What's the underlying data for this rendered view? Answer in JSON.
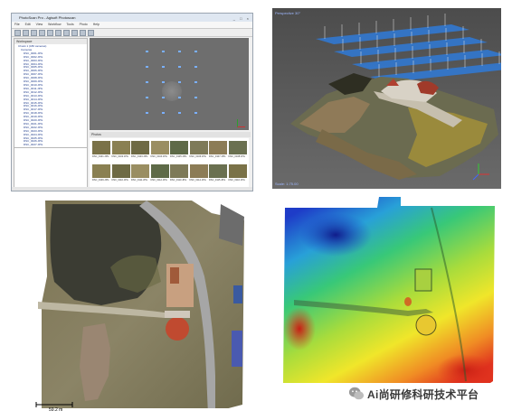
{
  "software_window": {
    "title": "PhotoScan Pro - Agisoft Photoscan",
    "menu": [
      "File",
      "Edit",
      "View",
      "Workflow",
      "Tools",
      "Photo",
      "Help"
    ],
    "workspace_header": "Workspace",
    "chunk_label": "Chunk 1 (186 cameras)",
    "cameras_folder": "Cameras",
    "camera_names": [
      "DSC_0001.JPG",
      "DSC_0002.JPG",
      "DSC_0003.JPG",
      "DSC_0004.JPG",
      "DSC_0005.JPG",
      "DSC_0006.JPG",
      "DSC_0007.JPG",
      "DSC_0008.JPG",
      "DSC_0009.JPG",
      "DSC_0010.JPG",
      "DSC_0011.JPG",
      "DSC_0012.JPG",
      "DSC_0013.JPG",
      "DSC_0014.JPG",
      "DSC_0015.JPG",
      "DSC_0016.JPG",
      "DSC_0017.JPG",
      "DSC_0018.JPG",
      "DSC_0019.JPG",
      "DSC_0020.JPG",
      "DSC_0021.JPG",
      "DSC_0022.JPG",
      "DSC_0023.JPG",
      "DSC_0024.JPG",
      "DSC_0025.JPG",
      "DSC_0026.JPG",
      "DSC_0027.JPG",
      "DSC_0028.JPG"
    ],
    "photos_header": "Photos",
    "thumbnail_labels": [
      "DSC_0101.JPG",
      "DSC_0102.JPG",
      "DSC_0103.JPG",
      "DSC_0104.JPG",
      "DSC_0105.JPG",
      "DSC_0106.JPG",
      "DSC_0107.JPG",
      "DSC_0108.JPG",
      "DSC_0109.JPG",
      "DSC_0110.JPG",
      "DSC_0111.JPG",
      "DSC_0112.JPG",
      "DSC_0113.JPG",
      "DSC_0114.JPG",
      "DSC_0115.JPG",
      "DSC_0116.JPG"
    ],
    "window_buttons": "_ □ ×"
  },
  "model_view": {
    "perspective_label": "Perspective 30°",
    "scale_label": "Scale: 1:75.00"
  },
  "orthomosaic": {
    "scale_bar_label": "59.2 m"
  },
  "dem": {
    "watermark_text": "Ai尚研修科研技术平台"
  },
  "colors": {
    "dem_high": "#e0321e",
    "dem_mid": "#f0e62a",
    "dem_low": "#1e3cc8",
    "water": "#3a3a30",
    "roads": "#a8a8a8"
  }
}
